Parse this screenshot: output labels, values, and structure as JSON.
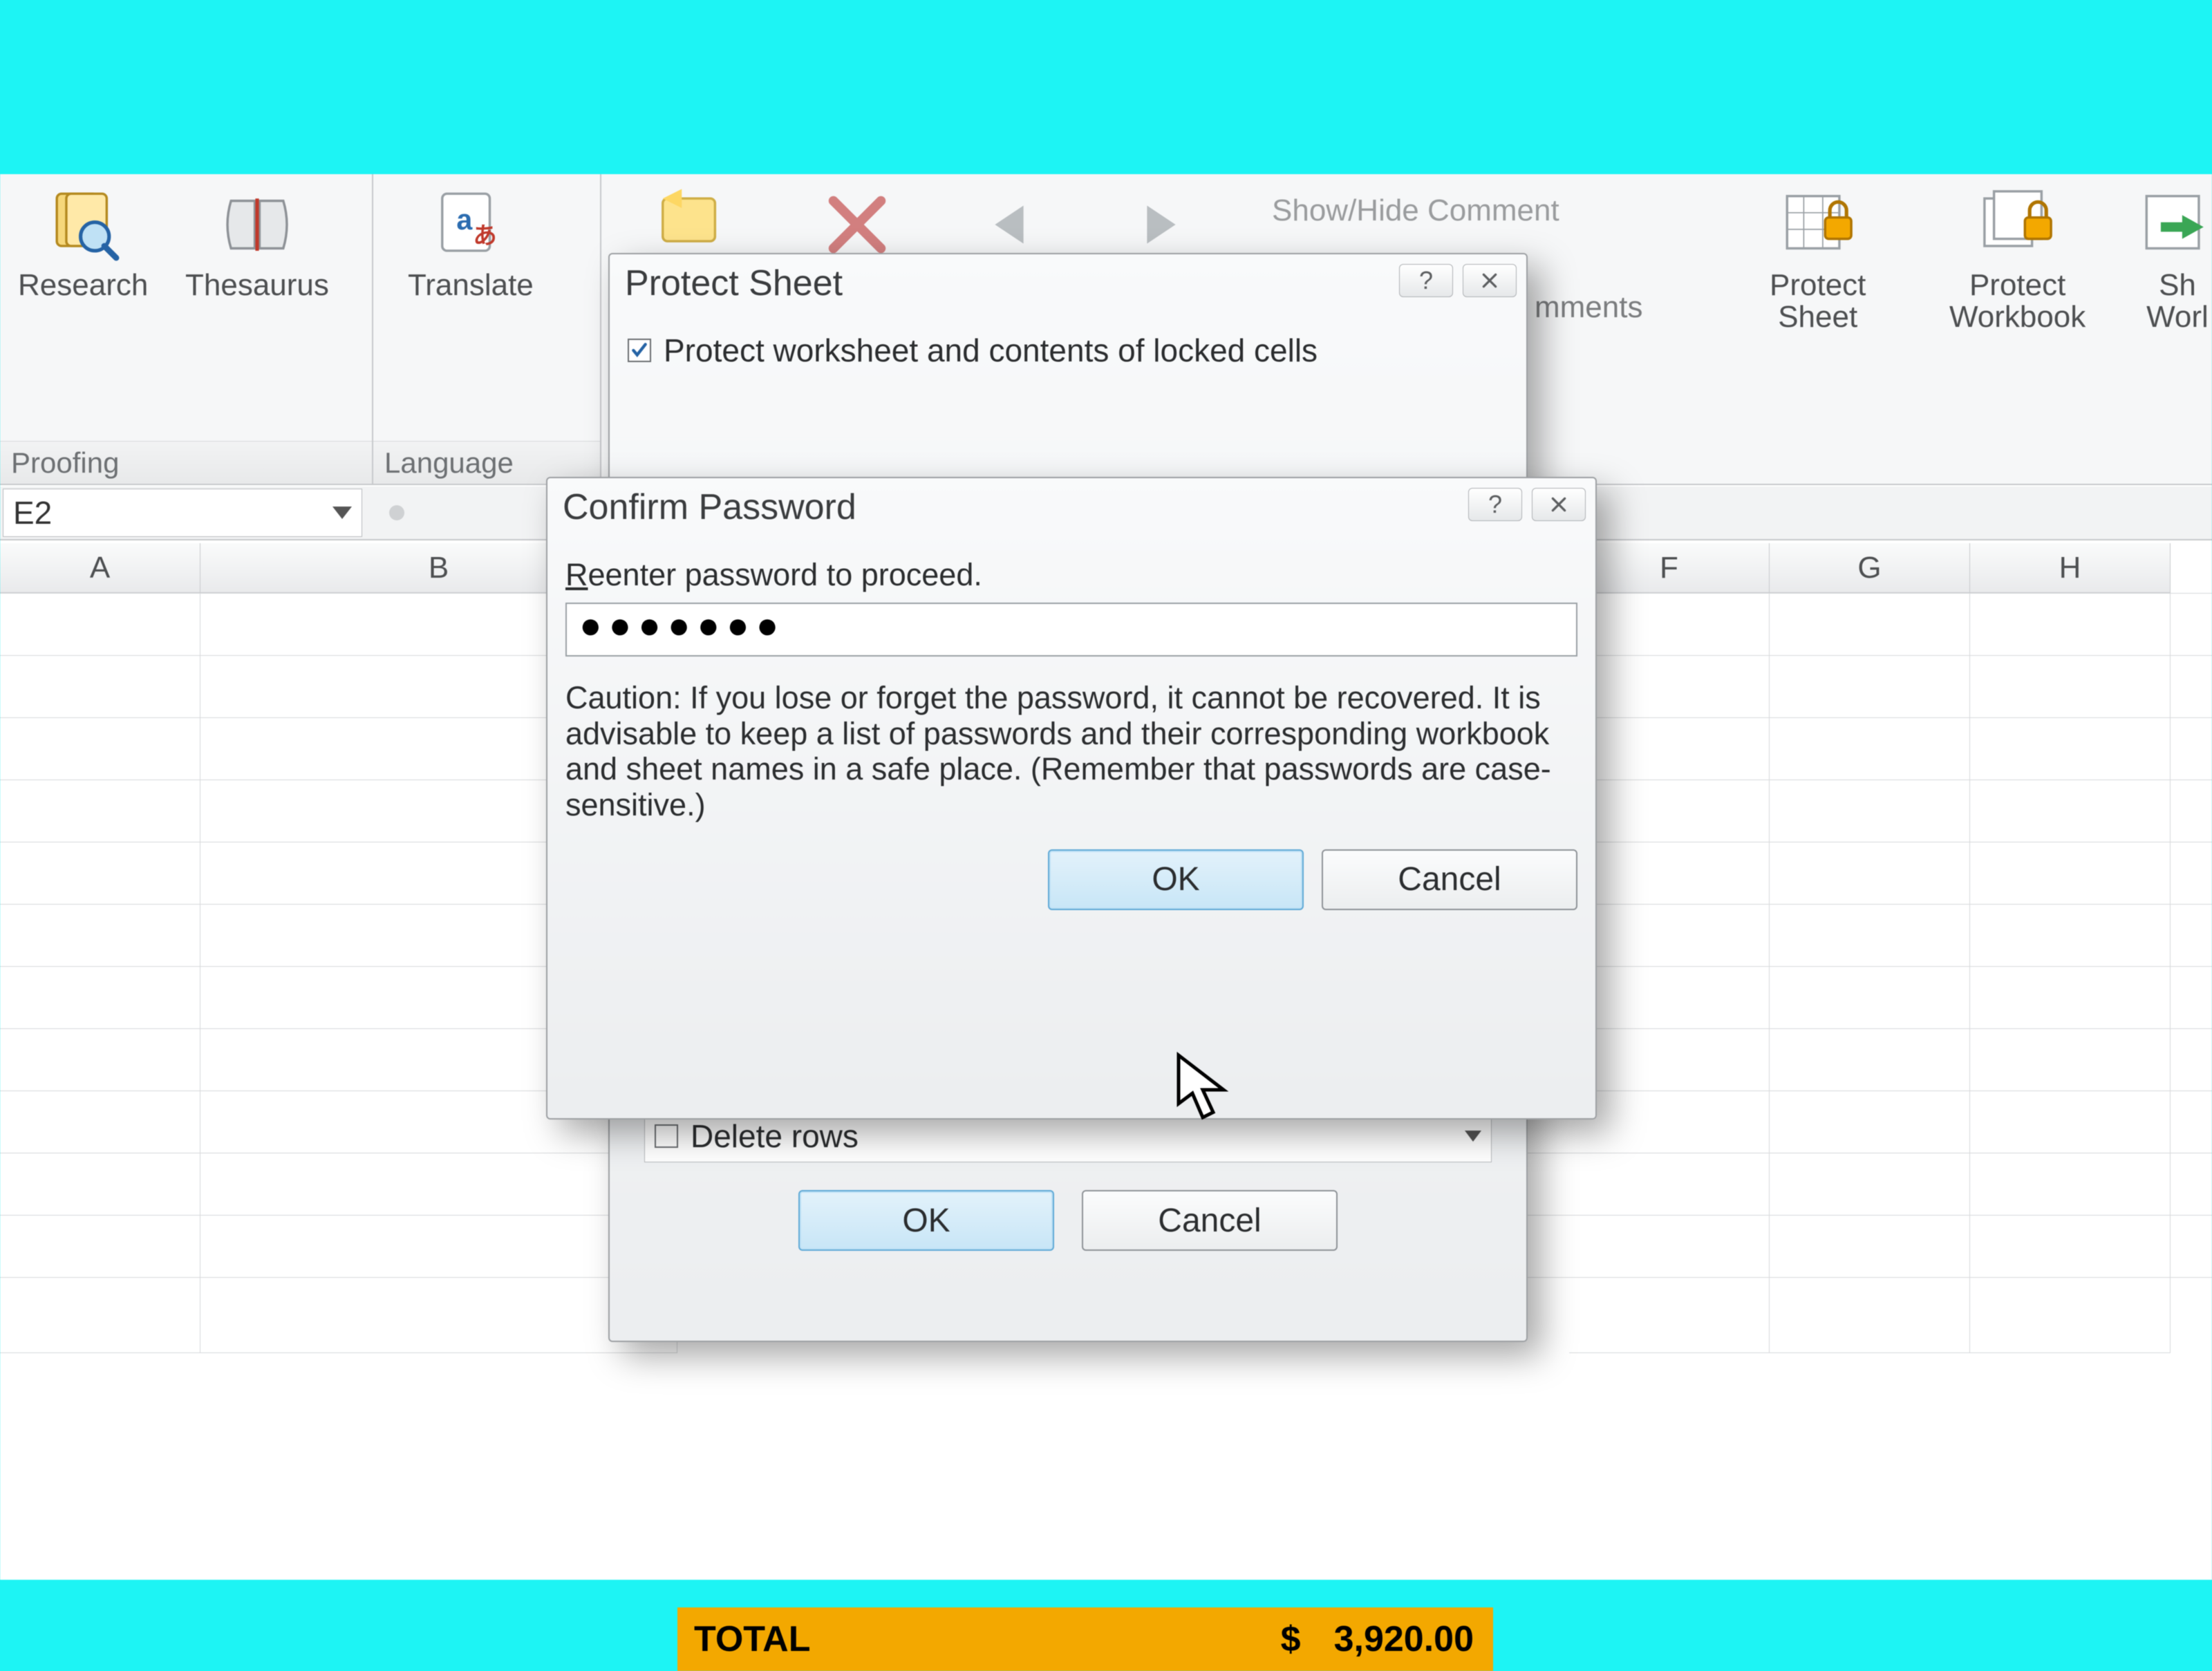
{
  "ribbon": {
    "proofing": {
      "label": "Proofing",
      "research": "Research",
      "thesaurus": "Thesaurus"
    },
    "language": {
      "label": "Language",
      "translate": "Translate"
    },
    "comments": {
      "show_hide": "Show/Hide Comment",
      "mments": "mments"
    },
    "protect": {
      "sheet": "Protect\nSheet",
      "workbook": "Protect\nWorkbook",
      "shared": "Sh\nWorl"
    }
  },
  "namebox": "E2",
  "columns": [
    "A",
    "B",
    "F",
    "G",
    "H"
  ],
  "total_row": {
    "label": "TOTAL",
    "currency": "$",
    "amount": "3,920.00"
  },
  "protect_dialog": {
    "title": "Protect Sheet",
    "chk_main": "Protect worksheet and contents of locked cells",
    "opt_delete_rows": "Delete rows",
    "ok": "OK",
    "cancel": "Cancel"
  },
  "confirm_dialog": {
    "title": "Confirm Password",
    "prompt": "Reenter password to proceed.",
    "password_mask": "●●●●●●●",
    "caution": "Caution: If you lose or forget the password, it cannot be recovered. It is advisable to keep a list of passwords and their corresponding workbook and sheet names in a safe place.  (Remember that passwords are case-sensitive.)",
    "ok": "OK",
    "cancel": "Cancel"
  }
}
